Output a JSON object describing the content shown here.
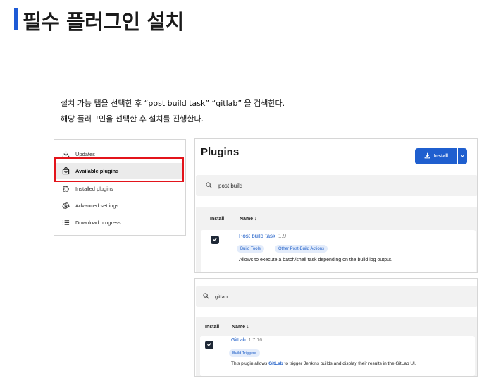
{
  "slide": {
    "title": "필수 플러그인 설치",
    "line1": "설치 가능 탭을 선택한 후 “post build task” “gitlab” 을 검색한다.",
    "line2": "해당 플러그인을 선택한 후 설치를 진행한다."
  },
  "sidebar": {
    "items": [
      {
        "label": "Updates",
        "icon": "download-icon"
      },
      {
        "label": "Available plugins",
        "icon": "shopping-bag-icon"
      },
      {
        "label": "Installed plugins",
        "icon": "puzzle-icon"
      },
      {
        "label": "Advanced settings",
        "icon": "gear-icon"
      },
      {
        "label": "Download progress",
        "icon": "list-icon"
      }
    ],
    "active_index": 1,
    "highlight_color": "#e3141b"
  },
  "plugins_panel": {
    "title": "Plugins",
    "install_label": "Install",
    "search_value": "post build",
    "col_install": "Install",
    "col_name": "Name ↓",
    "row": {
      "name": "Post build task",
      "version": "1.9",
      "tags": [
        "Build Tools",
        "Other Post-Build Actions"
      ],
      "description": "Allows to execute a batch/shell task depending on the build log output.",
      "checked": true
    }
  },
  "gitlab_panel": {
    "search_value": "gitlab",
    "col_install": "Install",
    "col_name": "Name ↓",
    "row": {
      "name": "GitLab",
      "version": "1.7.16",
      "tags": [
        "Build Triggers"
      ],
      "desc_before": "This plugin allows ",
      "desc_link": "GitLab",
      "desc_after": " to trigger Jenkins builds and display their results in the GitLab UI.",
      "checked": true
    }
  },
  "colors": {
    "accent": "#1f5fcf",
    "title_bar": "#1e5bd6",
    "link": "#2563c9"
  }
}
